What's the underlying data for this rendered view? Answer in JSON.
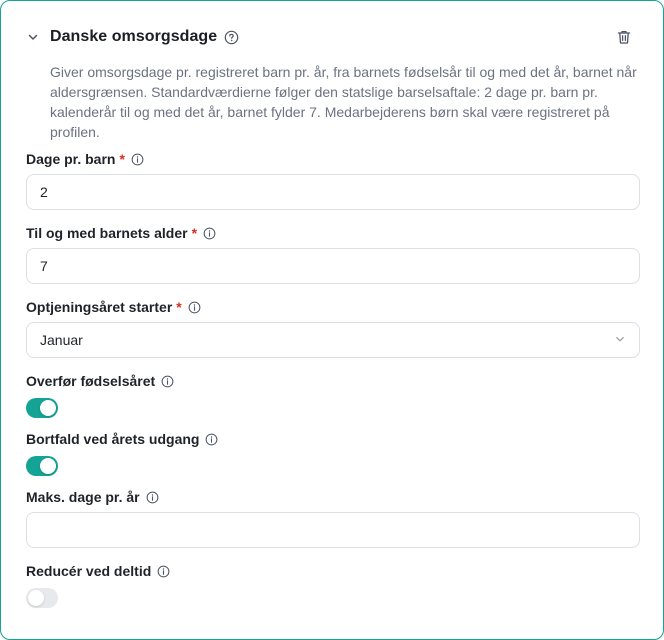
{
  "card": {
    "title": "Danske omsorgsdage",
    "description": "Giver omsorgsdage pr. registreret barn pr. år, fra barnets fødselsår til og med det år, barnet når aldersgrænsen. Standardværdierne følger den statslige barselsaftale: 2 dage pr. barn pr. kalenderår til og med det år, barnet fylder 7. Medarbejderens børn skal være registreret på profilen."
  },
  "fields": {
    "days_per_child": {
      "label": "Dage pr. barn",
      "required": "*",
      "value": "2"
    },
    "child_age_limit": {
      "label": "Til og med barnets alder",
      "required": "*",
      "value": "7"
    },
    "accrual_year_start": {
      "label": "Optjeningsåret starter",
      "required": "*",
      "value": "Januar"
    },
    "transfer_birth_year": {
      "label": "Overfør fødselsåret",
      "enabled": true
    },
    "expire_at_year_end": {
      "label": "Bortfald ved årets udgang",
      "enabled": true
    },
    "max_days_per_year": {
      "label": "Maks. dage pr. år",
      "value": ""
    },
    "reduce_part_time": {
      "label": "Reducér ved deltid",
      "enabled": false
    }
  },
  "colors": {
    "accent": "#14a394",
    "required": "#d92d20",
    "muted_text": "#6b7280",
    "toggle_off": "#e7e9ec"
  },
  "icons": {
    "collapse": "chevron-down-icon",
    "help": "help-circle-icon",
    "delete": "trash-icon",
    "info": "info-icon",
    "select": "chevron-down-icon"
  }
}
